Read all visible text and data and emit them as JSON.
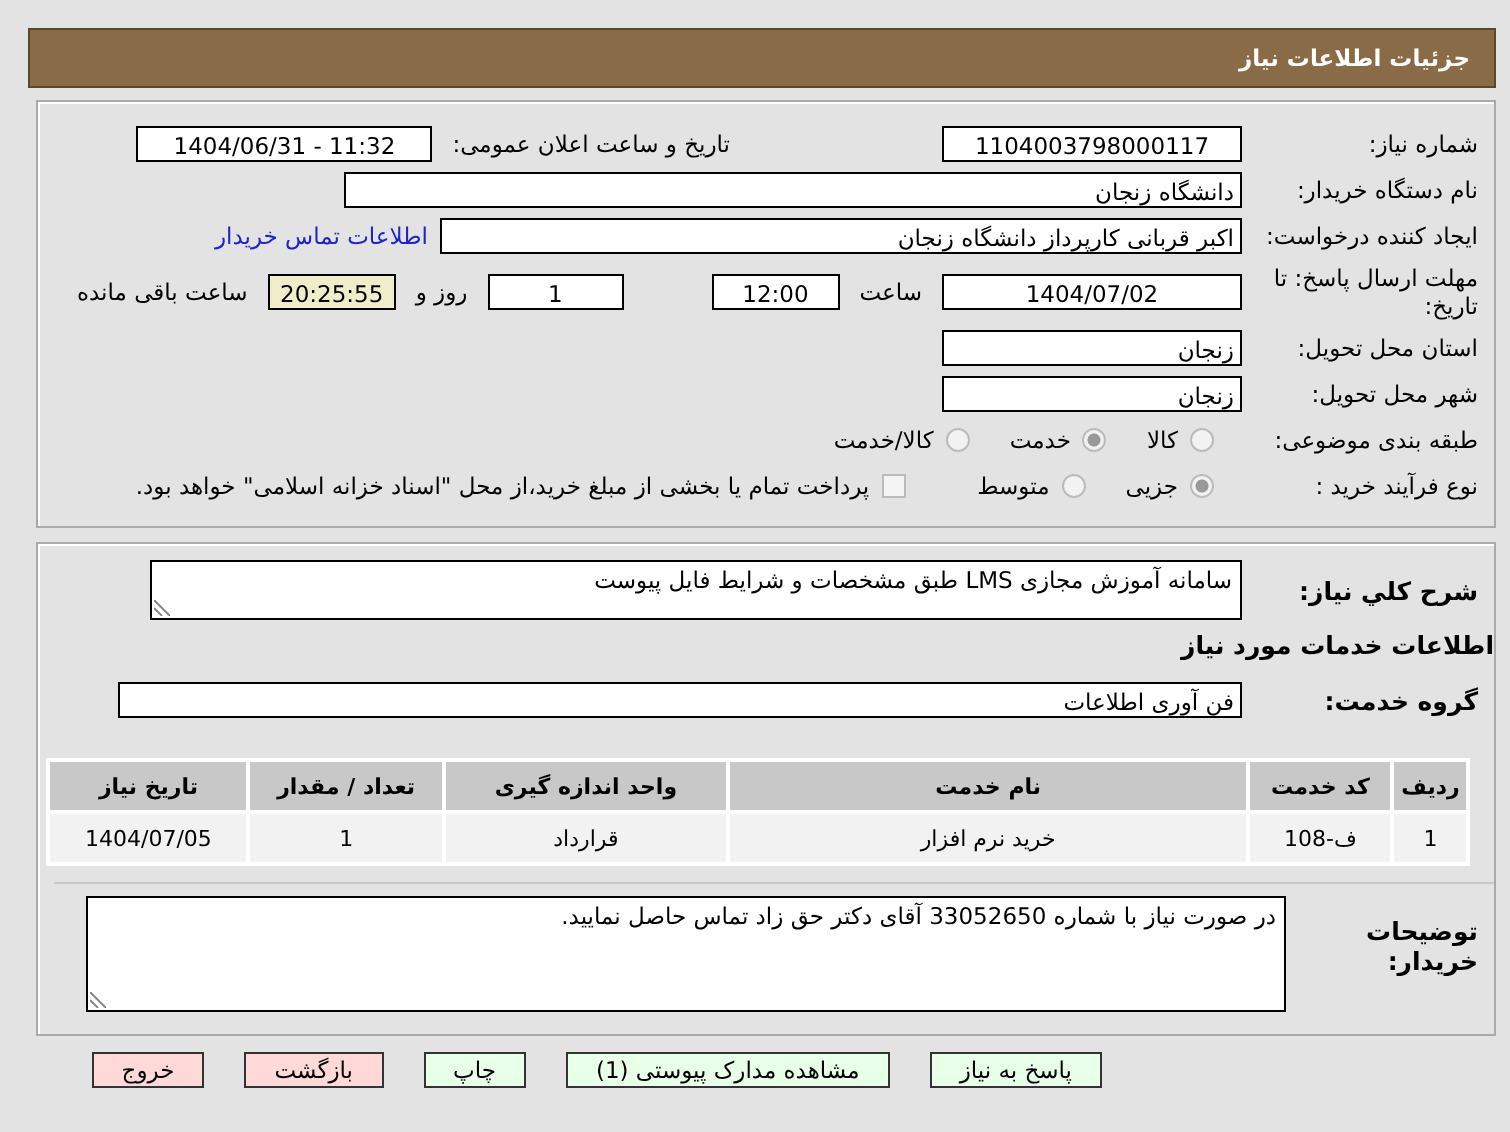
{
  "header": {
    "title": "جزئیات اطلاعات نیاز"
  },
  "need_number": {
    "label": "شماره نیاز:",
    "value": "1104003798000117"
  },
  "announce": {
    "label": "تاریخ و ساعت اعلان عمومی:",
    "value": "1404/06/31 - 11:32"
  },
  "buyer": {
    "label": "نام دستگاه خریدار:",
    "value": "دانشگاه زنجان"
  },
  "creator": {
    "label": "ایجاد کننده درخواست:",
    "value": "اکبر قربانی کارپرداز دانشگاه زنجان",
    "link": "اطلاعات تماس خریدار"
  },
  "deadline": {
    "label": "مهلت ارسال پاسخ: تا تاریخ:",
    "date": "1404/07/02",
    "time_label": "ساعت",
    "time": "12:00",
    "days": "1",
    "days_label": "روز و",
    "remaining": "20:25:55",
    "remaining_label": "ساعت باقی مانده"
  },
  "province": {
    "label": "استان محل تحویل:",
    "value": "زنجان"
  },
  "city": {
    "label": "شهر محل تحویل:",
    "value": "زنجان"
  },
  "category": {
    "label": "طبقه بندی موضوعی:",
    "options": [
      {
        "label": "کالا",
        "selected": false
      },
      {
        "label": "خدمت",
        "selected": true
      },
      {
        "label": "کالا/خدمت",
        "selected": false
      }
    ]
  },
  "process": {
    "label": "نوع فرآیند خرید :",
    "options": [
      {
        "label": "جزیی",
        "selected": true
      },
      {
        "label": "متوسط",
        "selected": false
      }
    ],
    "payment": {
      "checked": false,
      "text": "پرداخت تمام یا بخشی از مبلغ خرید،از محل \"اسناد خزانه اسلامی\" خواهد بود."
    }
  },
  "description": {
    "label": "شرح کلي نياز:",
    "value": "سامانه آموزش مجازی LMS طبق مشخصات و شرایط فایل پیوست"
  },
  "services_title": "اطلاعات خدمات مورد نیاز",
  "service_group": {
    "label": "گروه خدمت:",
    "value": "فن آوری اطلاعات"
  },
  "table": {
    "columns": [
      "ردیف",
      "کد خدمت",
      "نام خدمت",
      "واحد اندازه گیری",
      "تعداد / مقدار",
      "تاریخ نیاز"
    ],
    "rows": [
      [
        "1",
        "ف-108",
        "خرید نرم افزار",
        "قرارداد",
        "1",
        "1404/07/05"
      ]
    ]
  },
  "notes": {
    "label": "توضیحات خریدار:",
    "value": "در صورت نیاز با شماره 33052650 آقای دکتر حق زاد تماس حاصل نمایید."
  },
  "buttons": [
    {
      "label": "پاسخ به نیاز",
      "kind": "action"
    },
    {
      "label": "مشاهده مدارک پیوستی (1)",
      "kind": "action"
    },
    {
      "label": "چاپ",
      "kind": "action"
    },
    {
      "label": "بازگشت",
      "kind": "exit"
    },
    {
      "label": "خروج",
      "kind": "exit"
    }
  ]
}
